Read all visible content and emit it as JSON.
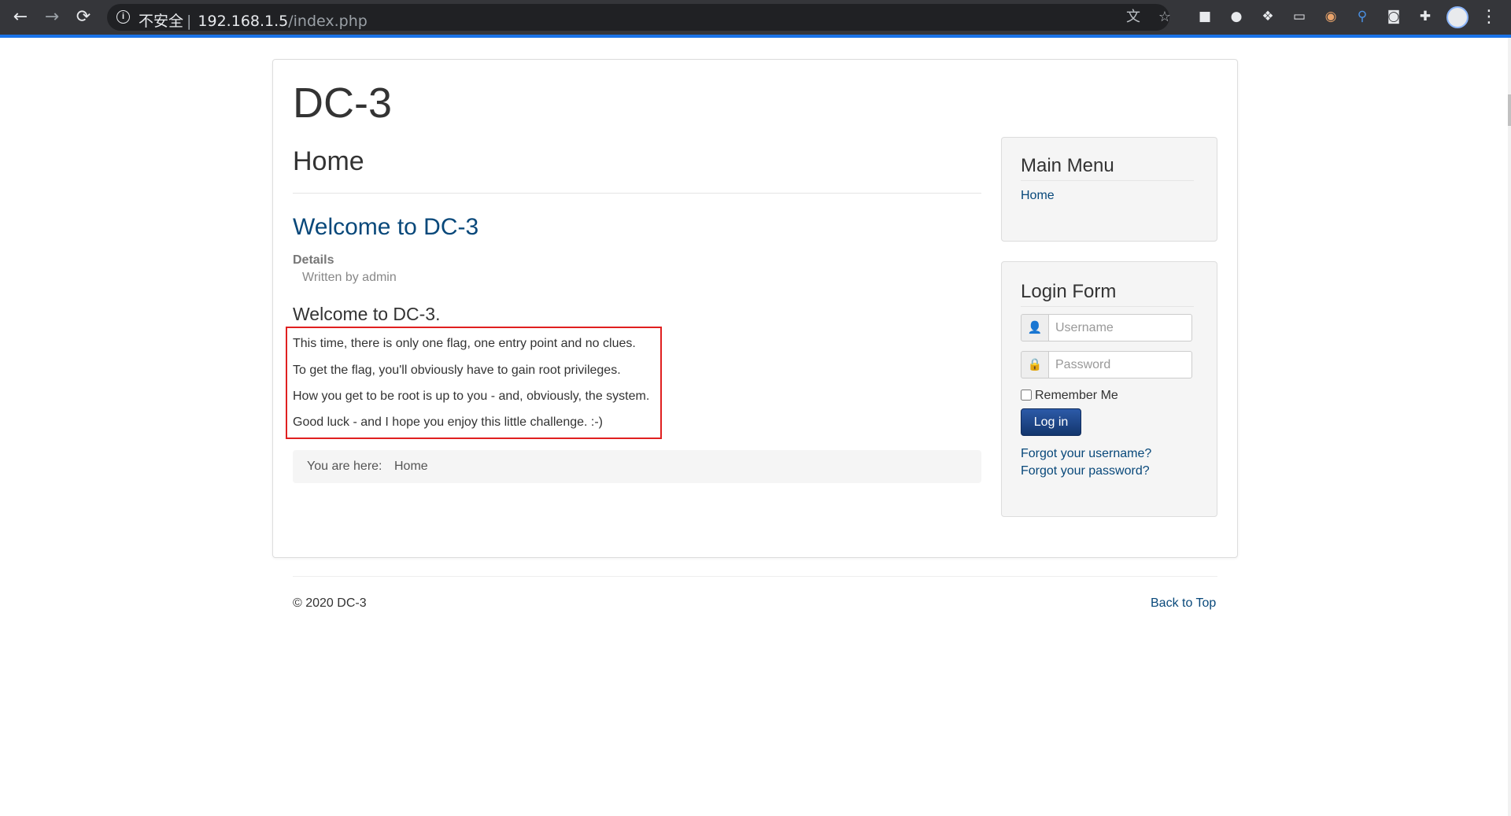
{
  "browser": {
    "back_icon": "←",
    "forward_icon": "→",
    "reload_icon": "⟳",
    "info_icon": "i",
    "security_label": "不安全",
    "url_host": "192.168.1.5",
    "url_path": "/index.php",
    "translate_icon": "文",
    "star_icon": "☆",
    "menu_icon": "⋮"
  },
  "site": {
    "title": "DC-3",
    "page_heading": "Home"
  },
  "article": {
    "title": "Welcome to DC-3",
    "details_label": "Details",
    "written_by": "Written by admin",
    "subheading": "Welcome to DC-3.",
    "lines": [
      "This time, there is only one flag, one entry point and no clues.",
      "To get the flag, you'll obviously have to gain root privileges.",
      "How you get to be root is up to you - and, obviously, the system.",
      "Good luck - and I hope you enjoy this little challenge.  :-)"
    ]
  },
  "breadcrumb": {
    "label": "You are here:",
    "item": "Home"
  },
  "main_menu": {
    "title": "Main Menu",
    "items": [
      "Home"
    ]
  },
  "login_form": {
    "title": "Login Form",
    "username_placeholder": "Username",
    "password_placeholder": "Password",
    "remember_label": "Remember Me",
    "login_button": "Log in",
    "forgot_username": "Forgot your username?",
    "forgot_password": "Forgot your password?"
  },
  "footer": {
    "copyright": "© 2020 DC-3",
    "back_to_top": "Back to Top"
  },
  "colors": {
    "link": "#08487a",
    "highlight_box": "#e02020",
    "chrome_bg": "#35363a"
  }
}
